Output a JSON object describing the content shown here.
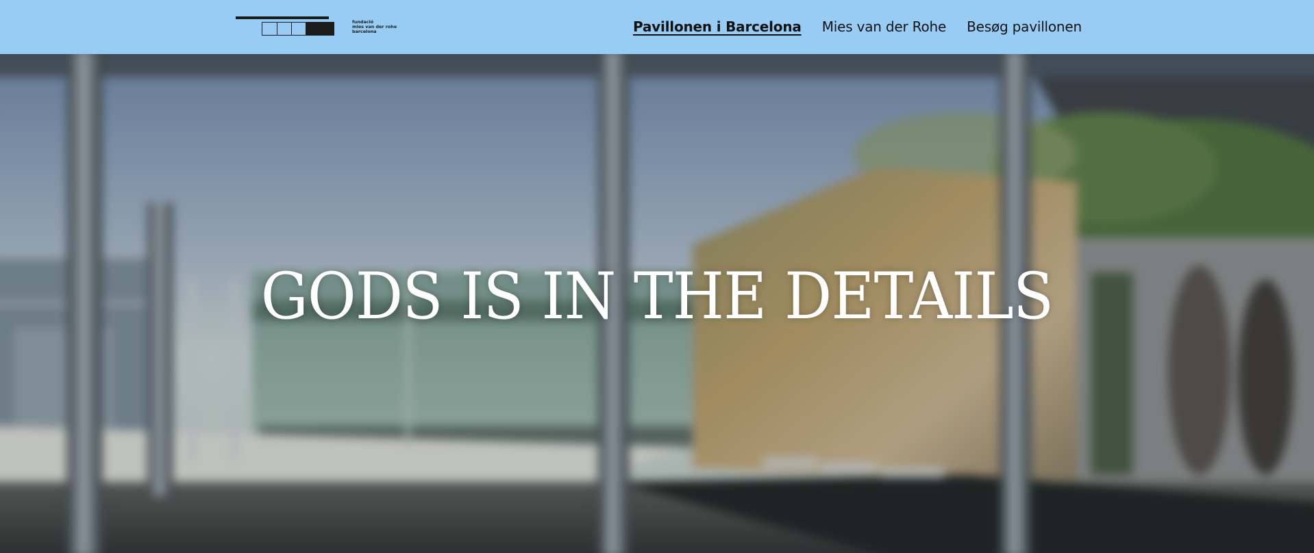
{
  "header": {
    "background_color": "#97cdf5",
    "logo": {
      "icon": "fundacio-mies-van-der-rohe-logo",
      "lines": [
        "fundació",
        "mies van der rohe",
        "barcelona"
      ]
    },
    "nav": [
      {
        "label": "Pavillonen i Barcelona",
        "active": true
      },
      {
        "label": "Mies van der Rohe",
        "active": false
      },
      {
        "label": "Besøg pavillonen",
        "active": false
      }
    ]
  },
  "hero": {
    "headline": "GODS IS IN THE DETAILS",
    "headline_color": "#ffffff",
    "image": "blurred-barcelona-pavilion-interior"
  }
}
